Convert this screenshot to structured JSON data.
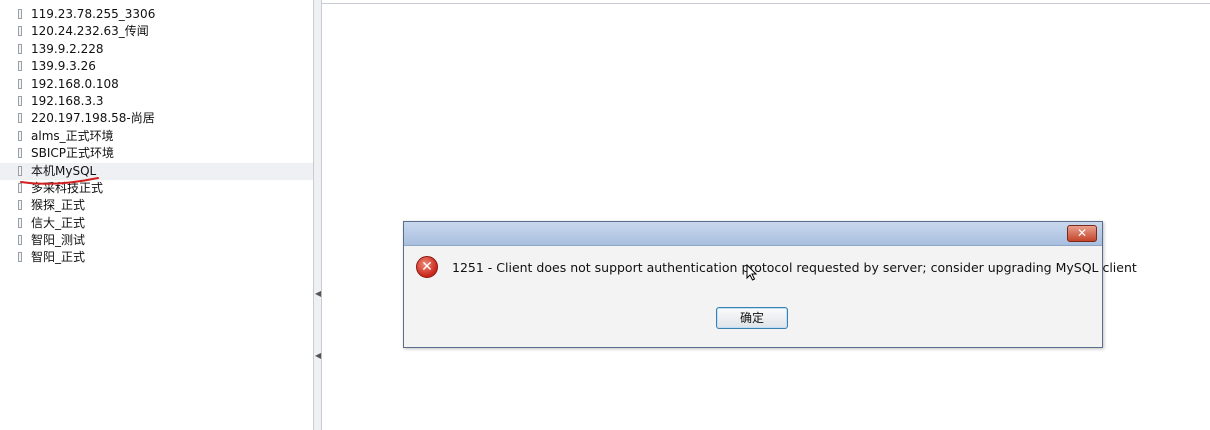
{
  "sidebar": {
    "connections": [
      {
        "label": "119.23.78.255_3306"
      },
      {
        "label": "120.24.232.63_传闻"
      },
      {
        "label": "139.9.2.228"
      },
      {
        "label": "139.9.3.26"
      },
      {
        "label": "192.168.0.108"
      },
      {
        "label": "192.168.3.3"
      },
      {
        "label": "220.197.198.58-尚居"
      },
      {
        "label": "alms_正式环境"
      },
      {
        "label": "SBICP正式环境"
      },
      {
        "label": "本机MySQL"
      },
      {
        "label": "多采科技正式"
      },
      {
        "label": "猴探_正式"
      },
      {
        "label": "信大_正式"
      },
      {
        "label": "智阳_测试"
      },
      {
        "label": "智阳_正式"
      }
    ],
    "selected_index": 9
  },
  "dialog": {
    "close_glyph": "✕",
    "icon": "error-icon",
    "message": "1251 - Client does not support authentication protocol requested by server; consider upgrading MySQL client",
    "ok_label": "确定"
  },
  "colors": {
    "annotation_red": "#d21f1f",
    "dialog_title_gradient": "#b7cae6",
    "close_button": "#c4452a"
  }
}
